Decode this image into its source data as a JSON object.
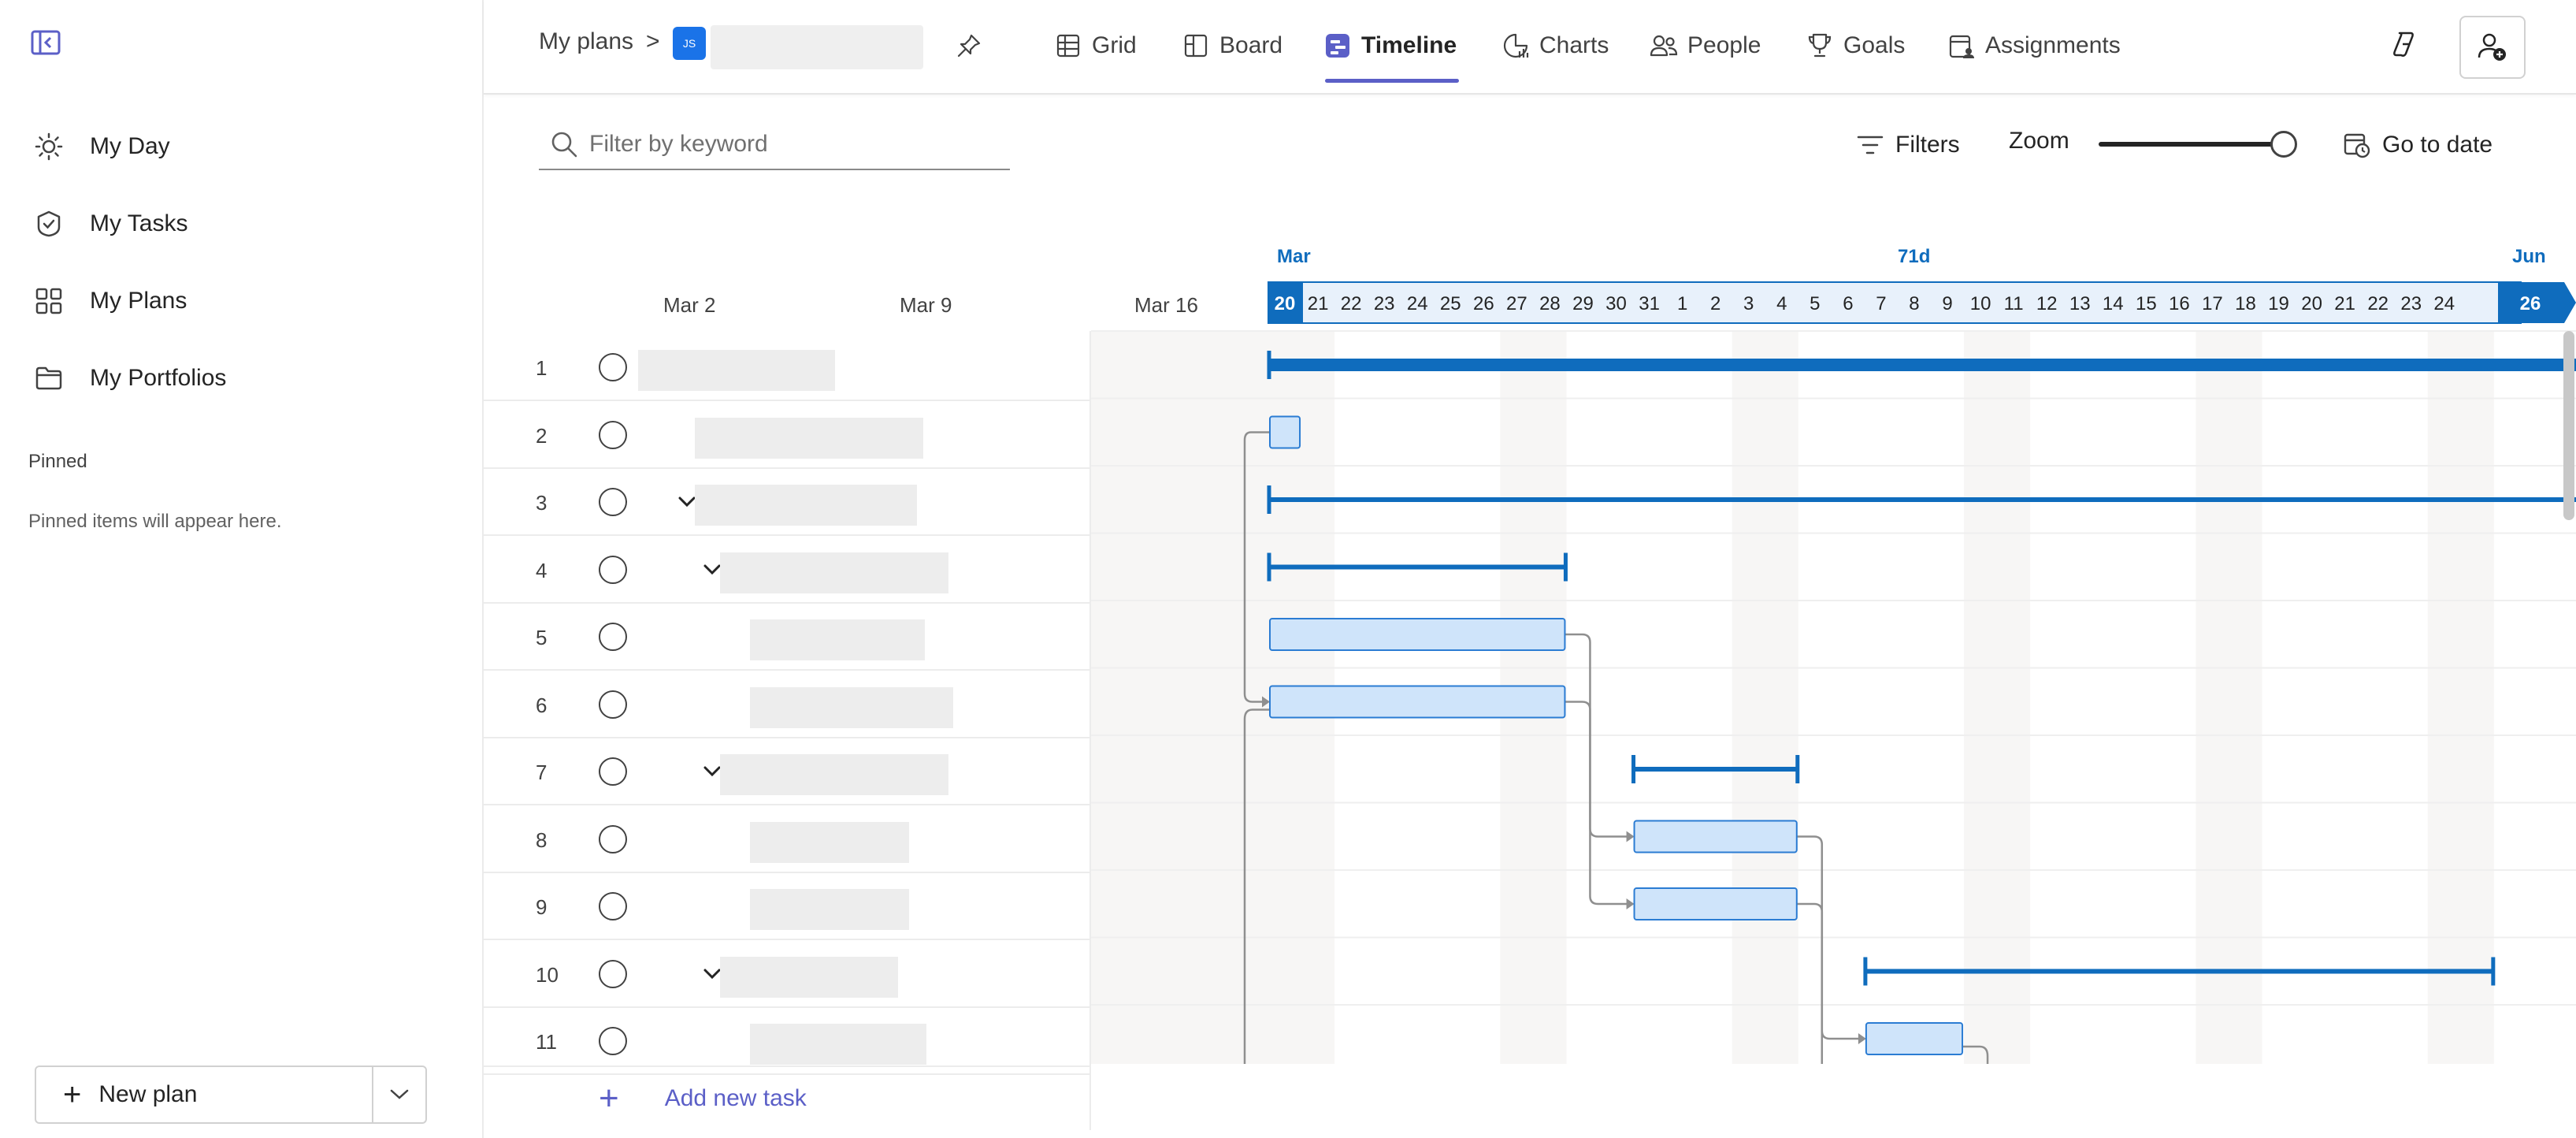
{
  "nav": {
    "items": [
      {
        "label": "My Day",
        "icon": "sun-icon"
      },
      {
        "label": "My Tasks",
        "icon": "task-check-icon"
      },
      {
        "label": "My Plans",
        "icon": "grid-apps-icon"
      },
      {
        "label": "My Portfolios",
        "icon": "folder-icon"
      }
    ],
    "pinned_title": "Pinned",
    "pinned_empty": "Pinned items will appear here.",
    "new_plan_label": "New plan"
  },
  "header": {
    "breadcrumb_root": "My plans",
    "breadcrumb_sep": ">",
    "plan_avatar_text": "JS",
    "tabs": [
      {
        "label": "Grid",
        "icon": "grid-icon",
        "active": false
      },
      {
        "label": "Board",
        "icon": "board-icon",
        "active": false
      },
      {
        "label": "Timeline",
        "icon": "timeline-icon",
        "active": true
      },
      {
        "label": "Charts",
        "icon": "charts-icon",
        "active": false
      },
      {
        "label": "People",
        "icon": "people-icon",
        "active": false
      },
      {
        "label": "Goals",
        "icon": "trophy-icon",
        "active": false
      },
      {
        "label": "Assignments",
        "icon": "assignments-icon",
        "active": false
      }
    ]
  },
  "toolbar": {
    "filter_placeholder": "Filter by keyword",
    "filters_label": "Filters",
    "zoom_label": "Zoom",
    "zoom_level": 1.0,
    "go_to_date_label": "Go to date"
  },
  "grid": {
    "week_labels": [
      "Mar 2",
      "Mar 9",
      "Mar 16"
    ],
    "rows": [
      {
        "num": "1",
        "indent": 0,
        "has_chevron": true
      },
      {
        "num": "2",
        "indent": 1,
        "has_chevron": false
      },
      {
        "num": "3",
        "indent": 1,
        "has_chevron": true
      },
      {
        "num": "4",
        "indent": 2,
        "has_chevron": true
      },
      {
        "num": "5",
        "indent": 3,
        "has_chevron": false
      },
      {
        "num": "6",
        "indent": 3,
        "has_chevron": false
      },
      {
        "num": "7",
        "indent": 2,
        "has_chevron": true
      },
      {
        "num": "8",
        "indent": 3,
        "has_chevron": false
      },
      {
        "num": "9",
        "indent": 3,
        "has_chevron": false
      },
      {
        "num": "10",
        "indent": 2,
        "has_chevron": true
      },
      {
        "num": "11",
        "indent": 3,
        "has_chevron": false
      }
    ],
    "add_task_label": "Add new task"
  },
  "timeline": {
    "range_label_start": "Mar",
    "range_label_mid": "71d",
    "range_label_end": "Jun",
    "days": [
      "20",
      "21",
      "22",
      "23",
      "24",
      "25",
      "26",
      "27",
      "28",
      "29",
      "30",
      "31",
      "1",
      "2",
      "3",
      "4",
      "5",
      "6",
      "7",
      "8",
      "9",
      "10",
      "11",
      "12",
      "13",
      "14",
      "15",
      "16",
      "17",
      "18",
      "19",
      "20",
      "21",
      "22",
      "23",
      "24"
    ],
    "end_day": "26",
    "bars": [
      {
        "row": 1,
        "kind": "summary",
        "start": "Mar 20",
        "end": "Jun 26"
      },
      {
        "row": 2,
        "kind": "task",
        "start": "Mar 20",
        "end": "Mar 20"
      },
      {
        "row": 3,
        "kind": "summary",
        "start": "Mar 20",
        "end": "Jun 26"
      },
      {
        "row": 4,
        "kind": "summary",
        "start": "Mar 20",
        "end": "Mar 28"
      },
      {
        "row": 5,
        "kind": "task",
        "start": "Mar 20",
        "end": "Mar 28"
      },
      {
        "row": 6,
        "kind": "task",
        "start": "Mar 20",
        "end": "Mar 28"
      },
      {
        "row": 7,
        "kind": "summary",
        "start": "Mar 31",
        "end": "Apr 4"
      },
      {
        "row": 8,
        "kind": "task",
        "start": "Mar 31",
        "end": "Apr 4"
      },
      {
        "row": 9,
        "kind": "task",
        "start": "Mar 31",
        "end": "Apr 4"
      },
      {
        "row": 10,
        "kind": "summary",
        "start": "Apr 7",
        "end": "Apr 25"
      },
      {
        "row": 11,
        "kind": "task",
        "start": "Apr 7",
        "end": "Apr 9"
      }
    ]
  },
  "colors": {
    "accent": "#5b5fc7",
    "timeline_blue": "#0f6cbd",
    "task_fill": "#cfe4fa",
    "task_stroke": "#2b7cd3",
    "weekend": "#f7f6f5",
    "connector": "#8f8f8f"
  }
}
